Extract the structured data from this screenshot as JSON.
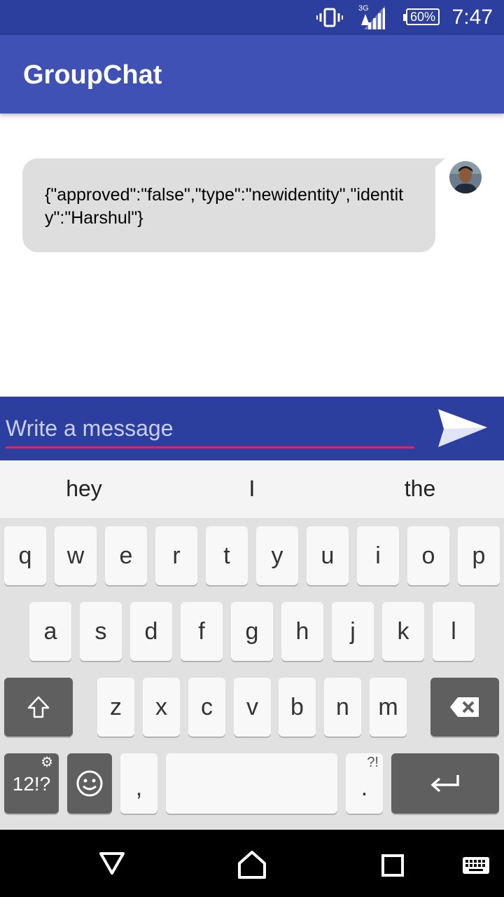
{
  "status_bar": {
    "time": "7:47",
    "battery": "60%",
    "network": "3G"
  },
  "app_bar": {
    "title": "GroupChat"
  },
  "message": {
    "text": "{\"approved\":\"false\",\"type\":\"newidentity\",\"identity\":\"Harshul\"}"
  },
  "composer": {
    "placeholder": "Write a message",
    "value": ""
  },
  "suggestions": [
    "hey",
    "I",
    "the"
  ],
  "keyboard": {
    "row1": [
      "q",
      "w",
      "e",
      "r",
      "t",
      "y",
      "u",
      "i",
      "o",
      "p"
    ],
    "row2": [
      "a",
      "s",
      "d",
      "f",
      "g",
      "h",
      "j",
      "k",
      "l"
    ],
    "row3": [
      "z",
      "x",
      "c",
      "v",
      "b",
      "n",
      "m"
    ],
    "symbols_label": "12!?",
    "comma": ",",
    "period": ".",
    "period_hint": "?!"
  },
  "icons": {
    "vibrate": "vibrate-icon",
    "signal": "signal-icon",
    "battery": "battery-icon",
    "send": "send-icon",
    "shift": "shift-icon",
    "backspace": "backspace-icon",
    "emoji": "emoji-icon",
    "enter": "enter-icon",
    "back": "back-icon",
    "home": "home-icon",
    "recents": "recents-icon",
    "keyboard": "keyboard-icon"
  },
  "colors": {
    "status_bar": "#2c3e9e",
    "app_bar": "#3f51b5",
    "accent": "#e91e63",
    "bubble": "#dedede"
  }
}
